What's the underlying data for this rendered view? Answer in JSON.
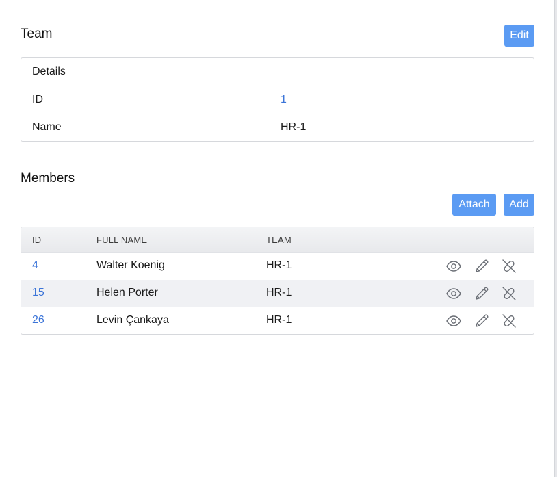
{
  "team_section": {
    "title": "Team",
    "edit_label": "Edit"
  },
  "details": {
    "header": "Details",
    "rows": [
      {
        "key": "ID",
        "value": "1"
      },
      {
        "key": "Name",
        "value": "HR-1"
      }
    ]
  },
  "members_section": {
    "title": "Members",
    "attach_label": "Attach",
    "add_label": "Add"
  },
  "members_table": {
    "columns": [
      "ID",
      "FULL NAME",
      "TEAM"
    ],
    "rows": [
      {
        "id": "4",
        "full_name": "Walter Koenig",
        "team": "HR-1"
      },
      {
        "id": "15",
        "full_name": "Helen Porter",
        "team": "HR-1"
      },
      {
        "id": "26",
        "full_name": "Levin Çankaya",
        "team": "HR-1"
      }
    ],
    "row_actions": [
      "eye-icon",
      "pencil-icon",
      "unlink-icon"
    ]
  },
  "colors": {
    "accent": "#5b9bf3",
    "link": "#3b74d8",
    "border": "#d6d8dc",
    "row_alt": "#f0f1f4"
  }
}
